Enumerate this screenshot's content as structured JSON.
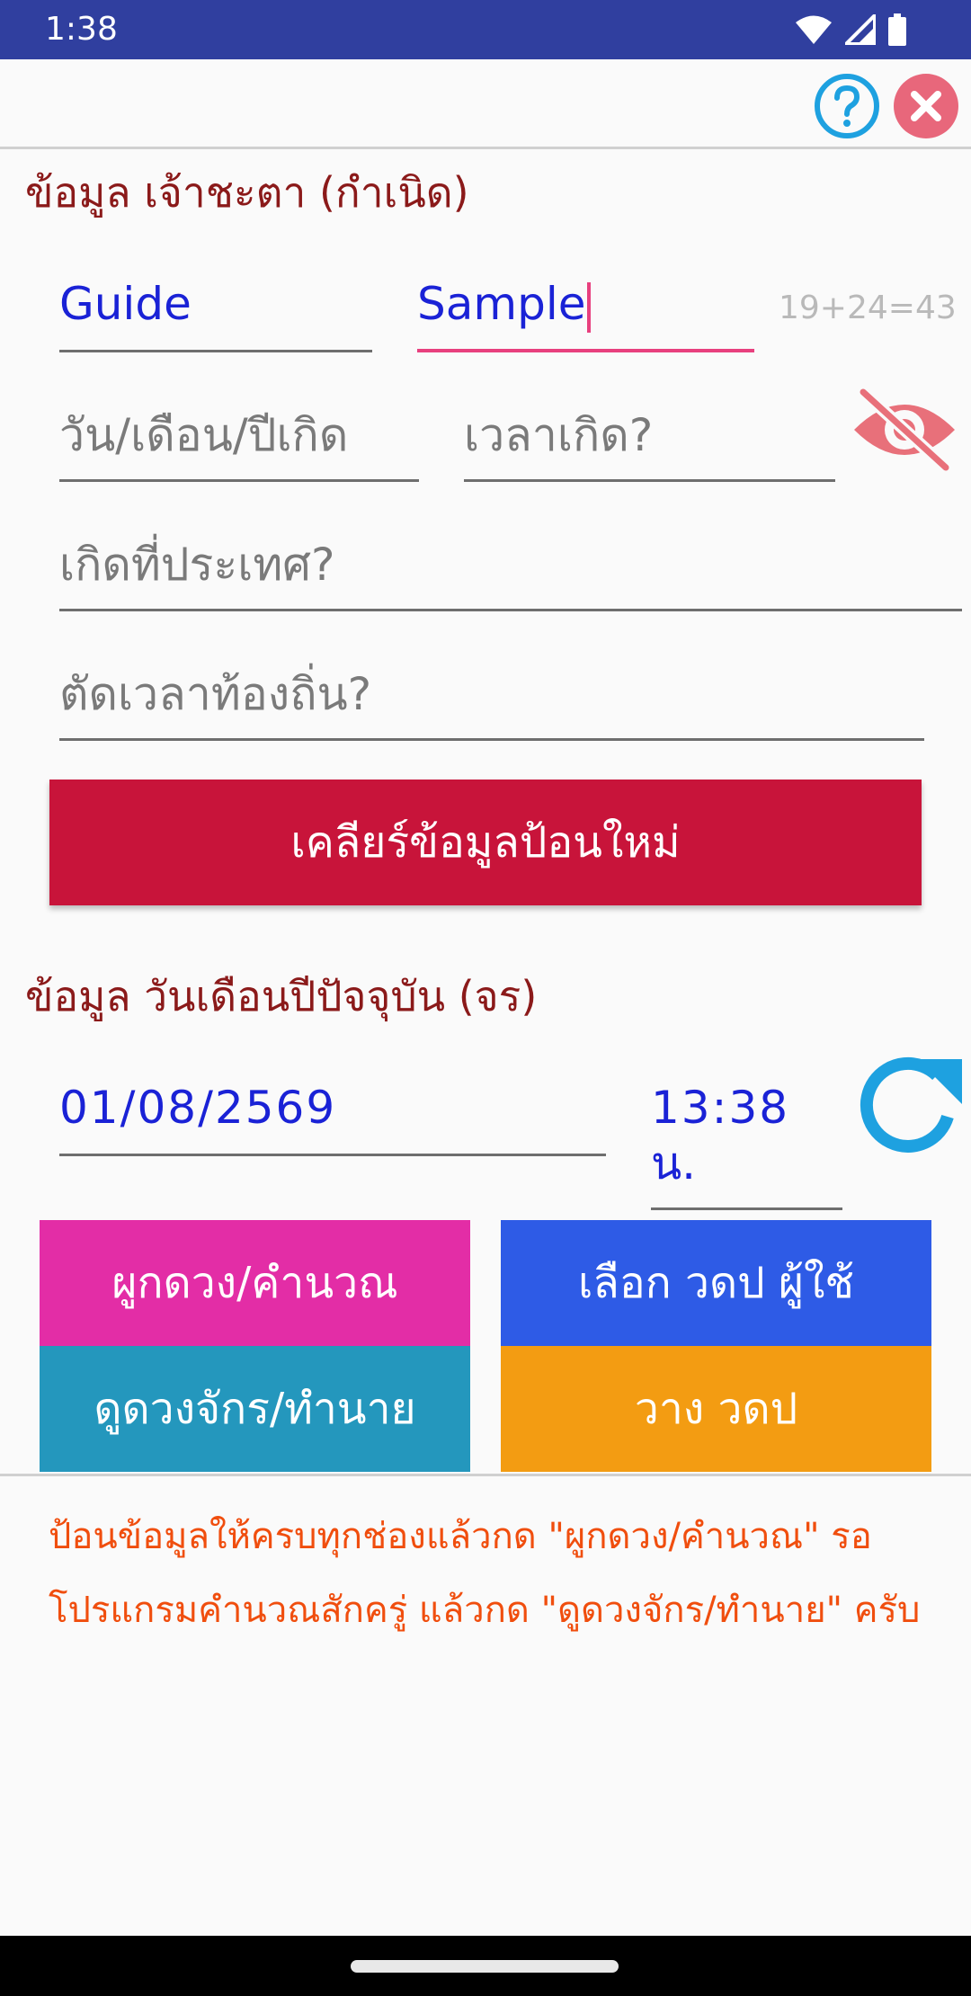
{
  "status_bar": {
    "time": "1:38",
    "icons": [
      "wifi-icon",
      "signal-icon",
      "battery-icon"
    ]
  },
  "toolbar": {
    "help_icon": "question-circle-icon",
    "close_icon": "close-circle-icon"
  },
  "birth_section": {
    "title": "ข้อมูล เจ้าชะตา (กำเนิด)",
    "first_name": {
      "value": "Guide"
    },
    "last_name": {
      "value": "Sample"
    },
    "name_counter": "19+24=43",
    "birth_date": {
      "placeholder": "วัน/เดือน/ปีเกิด"
    },
    "birth_time": {
      "placeholder": "เวลาเกิด?"
    },
    "visibility_icon": "eye-off-icon",
    "birth_country": {
      "placeholder": "เกิดที่ประเทศ?"
    },
    "local_time_adjust": {
      "placeholder": "ตัดเวลาท้องถิ่น?"
    },
    "clear_button": "เคลียร์ข้อมูลป้อนใหม่"
  },
  "current_section": {
    "title": "ข้อมูล วันเดือนปีปัจจุบัน (จร)",
    "date": "01/08/2569",
    "time": "13:38",
    "time_unit": "น.",
    "refresh_icon": "refresh-icon"
  },
  "actions": {
    "calculate": "ผูกดวง/คำนวณ",
    "select_user": "เลือก วดป ผู้ใช้",
    "view_chart": "ดูดวงจักร/ทำนาย",
    "place_date": "วาง วดป"
  },
  "instructions": {
    "line1": "ป้อนข้อมูลให้ครบทุกช่องแล้วกด \"ผูกดวง/คำนวณ\" รอ",
    "line2": "โปรแกรมคำนวณสักครู่ แล้วกด \"ดูดวงจักร/ทำนาย\" ครับ"
  },
  "colors": {
    "status_bar": "#303f9f",
    "title_text": "#8b1a1a",
    "input_blue": "#1a22d6",
    "accent_pink": "#e8407e",
    "clear_button": "#c8143a",
    "calculate_button": "#e32da6",
    "select_user_button": "#2e5be6",
    "view_chart_button": "#2497bd",
    "place_date_button": "#f39c12",
    "instructions_text": "#f04e0e",
    "help_icon": "#1ea1e0",
    "close_icon": "#e8677b"
  }
}
